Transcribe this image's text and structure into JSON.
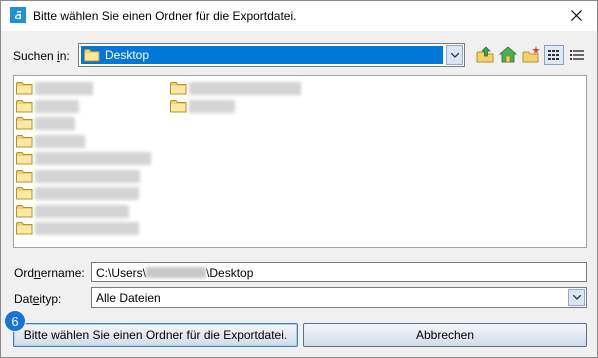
{
  "window": {
    "title": "Bitte wählen Sie einen Ordner für die Exportdatei."
  },
  "lookin": {
    "label_pre": "Suchen ",
    "label_key": "i",
    "label_post": "n:",
    "value": "Desktop"
  },
  "toolbar": {
    "icons": [
      "up-folder-icon",
      "home-icon",
      "new-folder-icon",
      "list-view-icon",
      "details-view-icon"
    ]
  },
  "files": [
    {
      "name": "Item 1"
    },
    {
      "name": "Item 2"
    },
    {
      "name": "Item 3"
    },
    {
      "name": "Item 4"
    },
    {
      "name": "Item 5"
    },
    {
      "name": "Item 6"
    },
    {
      "name": "Item 7"
    },
    {
      "name": "Item 8"
    },
    {
      "name": "Item 9"
    },
    {
      "name": "Item 10"
    },
    {
      "name": "Item 11"
    }
  ],
  "foldername": {
    "label_pre": "Ord",
    "label_key": "n",
    "label_post": "ername:",
    "value_prefix": "C:\\Users\\",
    "value_suffix": "\\Desktop"
  },
  "filetype": {
    "label_pre": "Dat",
    "label_key": "e",
    "label_post": "ityp:",
    "value": "Alle Dateien"
  },
  "buttons": {
    "select_label": "Bitte wählen Sie einen Ordner für die Exportdatei.",
    "cancel_label": "Abbrechen"
  },
  "badge": {
    "number": "6"
  },
  "colors": {
    "selection": "#0078d7",
    "folder": "#f3c95c",
    "badge": "#1a73d9"
  }
}
